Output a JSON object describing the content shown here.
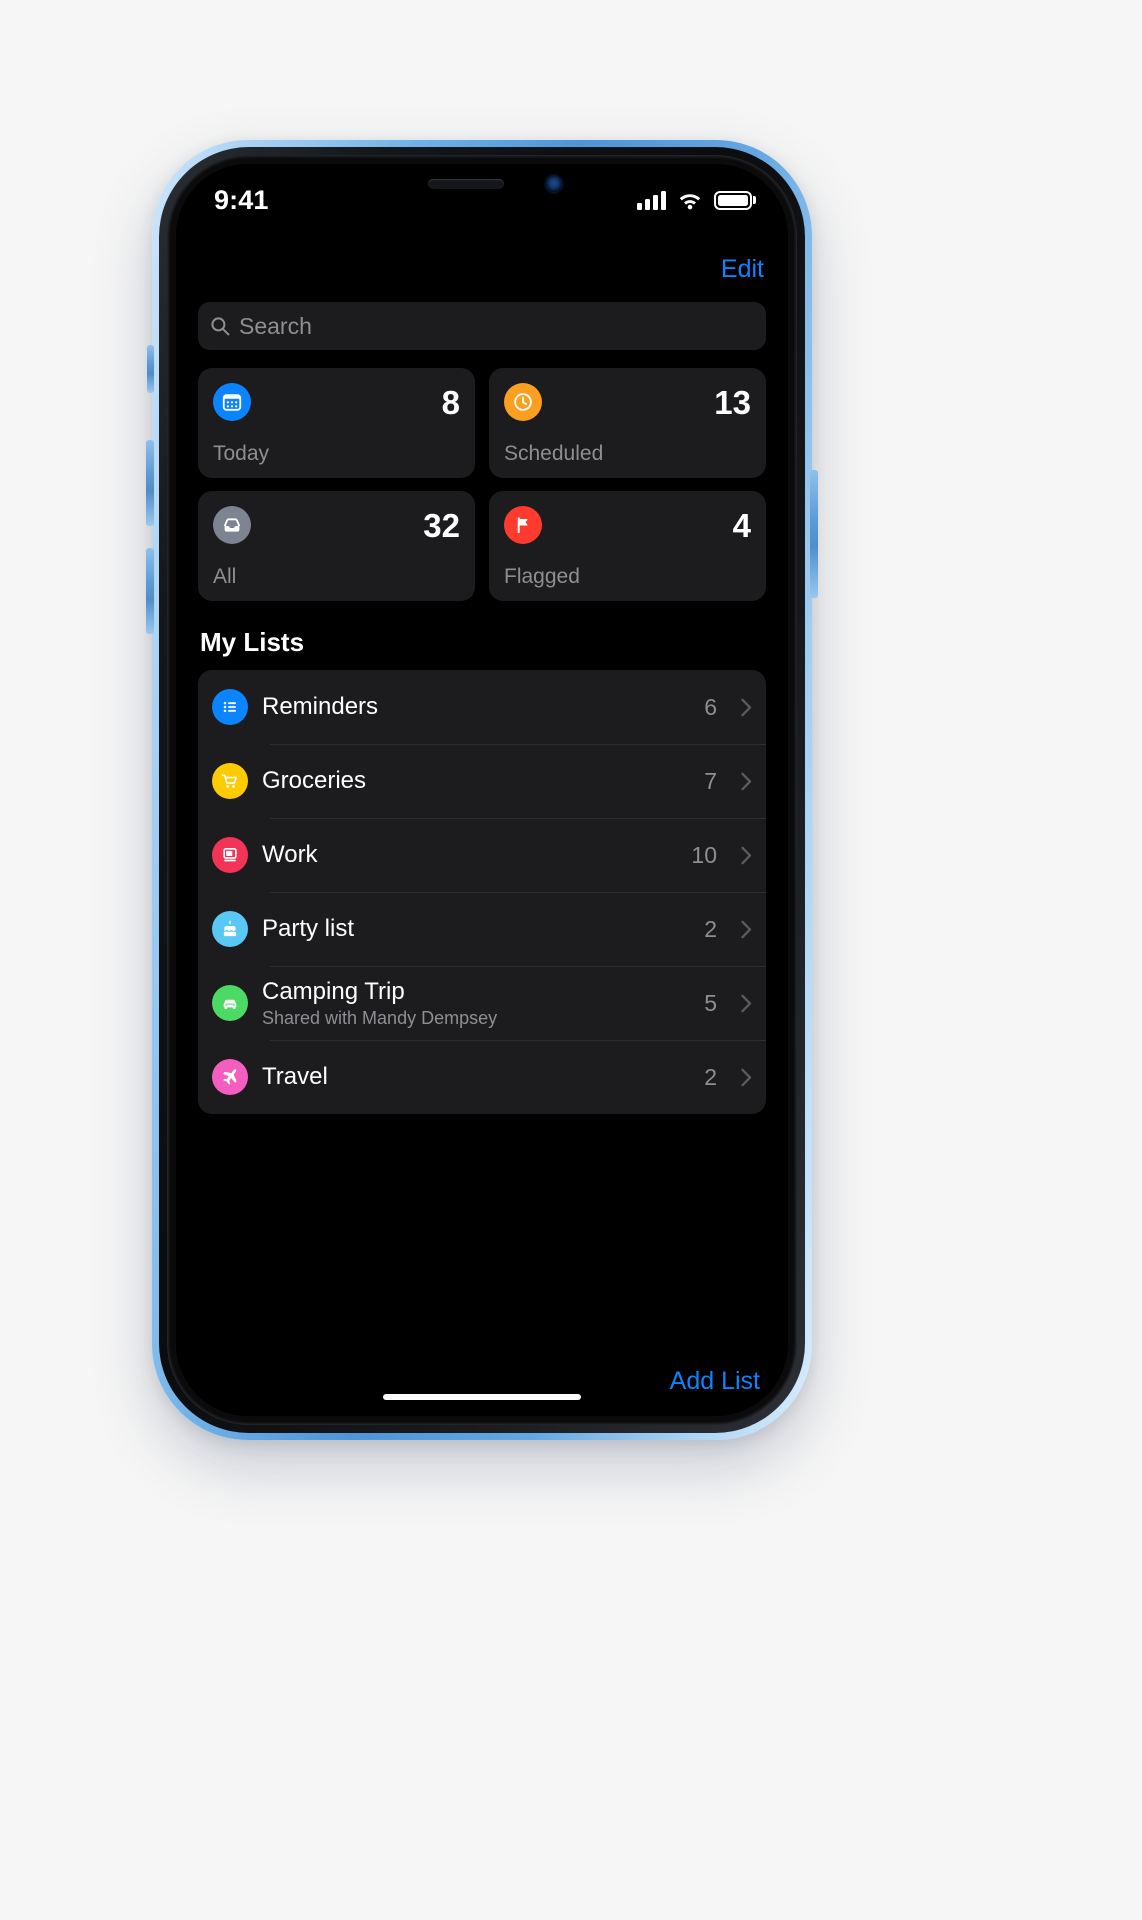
{
  "device": {
    "name": "iPhone XR",
    "body_color": "#6fb1e8"
  },
  "status_bar": {
    "time": "9:41",
    "cellular_icon": "cellular-bars-icon",
    "cellular_bars": 4,
    "wifi_icon": "wifi-icon",
    "battery_icon": "battery-full-icon",
    "battery_level": 100
  },
  "navbar": {
    "edit_label": "Edit"
  },
  "search": {
    "placeholder": "Search",
    "icon": "search-icon",
    "value": ""
  },
  "smart_lists": [
    {
      "label": "Today",
      "count": "8",
      "icon": "calendar-icon",
      "color": "#0a84ff"
    },
    {
      "label": "Scheduled",
      "count": "13",
      "icon": "clock-icon",
      "color": "#fa9f20"
    },
    {
      "label": "All",
      "count": "32",
      "icon": "inbox-icon",
      "color": "#7d8491"
    },
    {
      "label": "Flagged",
      "count": "4",
      "icon": "flag-icon",
      "color": "#ff3b30"
    }
  ],
  "my_lists": {
    "title": "My Lists",
    "items": [
      {
        "name": "Reminders",
        "subtitle": "",
        "count": "6",
        "icon": "list-bullet-icon",
        "color": "#0a84ff"
      },
      {
        "name": "Groceries",
        "subtitle": "",
        "count": "7",
        "icon": "shopping-cart-icon",
        "color": "#fecb00"
      },
      {
        "name": "Work",
        "subtitle": "",
        "count": "10",
        "icon": "desktop-computer-icon",
        "color": "#f23557"
      },
      {
        "name": "Party list",
        "subtitle": "",
        "count": "2",
        "icon": "birthday-cake-icon",
        "color": "#5ac8f5"
      },
      {
        "name": "Camping Trip",
        "subtitle": "Shared with Mandy Dempsey",
        "count": "5",
        "icon": "car-icon",
        "color": "#4cd964"
      },
      {
        "name": "Travel",
        "subtitle": "",
        "count": "2",
        "icon": "airplane-icon",
        "color": "#f45ec0"
      }
    ]
  },
  "footer": {
    "add_list_label": "Add List"
  },
  "accent_colors": {
    "blue": "#0a84ff",
    "card_bg": "#1c1c1e",
    "secondary_text": "#8e8e93",
    "screen_bg": "#000000"
  }
}
